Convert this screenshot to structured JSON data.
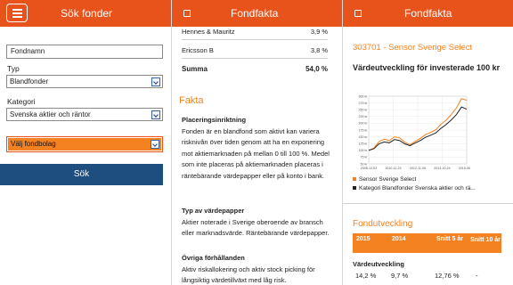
{
  "colors": {
    "accent": "#e8521b",
    "orange": "#f58220",
    "button": "#1e4d80"
  },
  "panel1": {
    "title": "Sök fonder",
    "fund_name_value": "Fondnamn",
    "typ_label": "Typ",
    "typ_value": "Blandfonder",
    "kategori_label": "Kategori",
    "kategori_value": "Svenska aktier och räntor",
    "bolag_value": "Välj fondbolag",
    "search_button": "Sök"
  },
  "panel2": {
    "title": "Fondfakta",
    "holdings": [
      {
        "name": "Hennes & Mauritz",
        "value": "3,9 %"
      },
      {
        "name": "Ericsson B",
        "value": "3,8 %"
      }
    ],
    "summa_label": "Summa",
    "summa_value": "54,0 %",
    "fakta_heading": "Fakta",
    "placering_heading": "Placeringsinriktning",
    "placering_text": "Fonden är en blandfond som aktivt kan variera risknivån över tiden genom att ha en exponering mot aktiemarknaden på mellan 0 till 100 %. Medel som inte placeras på aktiemarknaden placeras i räntebärande värdepapper eller på konto i bank.",
    "typ_heading": "Typ av värdepapper",
    "typ_text": "Aktier noterade i Sverige oberoende av bransch eller marknadsvärde. Räntebärande värdepapper.",
    "ovriga_heading": "Övriga förhållanden",
    "ovriga_text": "Aktiv riskallokering och aktiv stock picking för långsiktig värdetillväxt med låg risk."
  },
  "panel3": {
    "title": "Fondfakta",
    "fund_title": "303701 - Sensor Sverige Select",
    "chart_title": "Värdeutveckling för investerade 100 kr",
    "legend": [
      {
        "label": "Sensor Sverige Select",
        "color": "#f58220"
      },
      {
        "label": "Kategori Blandfonder Svenska aktier och rä...",
        "color": "#222222"
      }
    ],
    "fondutv_heading": "Fondutveckling",
    "table_headers": [
      "2015",
      "2014",
      "Snitt 5 år",
      "Snitt 10 år"
    ],
    "row_label": "Värdeutveckling",
    "row_values": [
      "14,2 %",
      "9,7 %",
      "12,76 %",
      "-"
    ]
  },
  "chart_data": {
    "type": "line",
    "title": "Värdeutveckling för investerade 100 kr",
    "x_ticks": [
      "2008-12-03",
      "2010-11-23",
      "2012-11-05",
      "2013-10-24",
      "2015-06-10"
    ],
    "y_ticks": [
      50,
      75,
      100,
      125,
      150,
      175,
      200,
      225,
      250,
      275,
      300
    ],
    "ylim": [
      50,
      300
    ],
    "grid": true,
    "series": [
      {
        "name": "Sensor Sverige Select",
        "color": "#f58220",
        "values": [
          100,
          108,
          132,
          141,
          136,
          150,
          146,
          130,
          121,
          133,
          144,
          158,
          166,
          176,
          196,
          211,
          232,
          256,
          291,
          285
        ]
      },
      {
        "name": "Kategori Blandfonder Svenska aktier och rä...",
        "color": "#222222",
        "values": [
          100,
          106,
          124,
          131,
          128,
          140,
          136,
          124,
          117,
          127,
          136,
          148,
          156,
          164,
          181,
          195,
          212,
          232,
          260,
          252
        ]
      }
    ]
  }
}
